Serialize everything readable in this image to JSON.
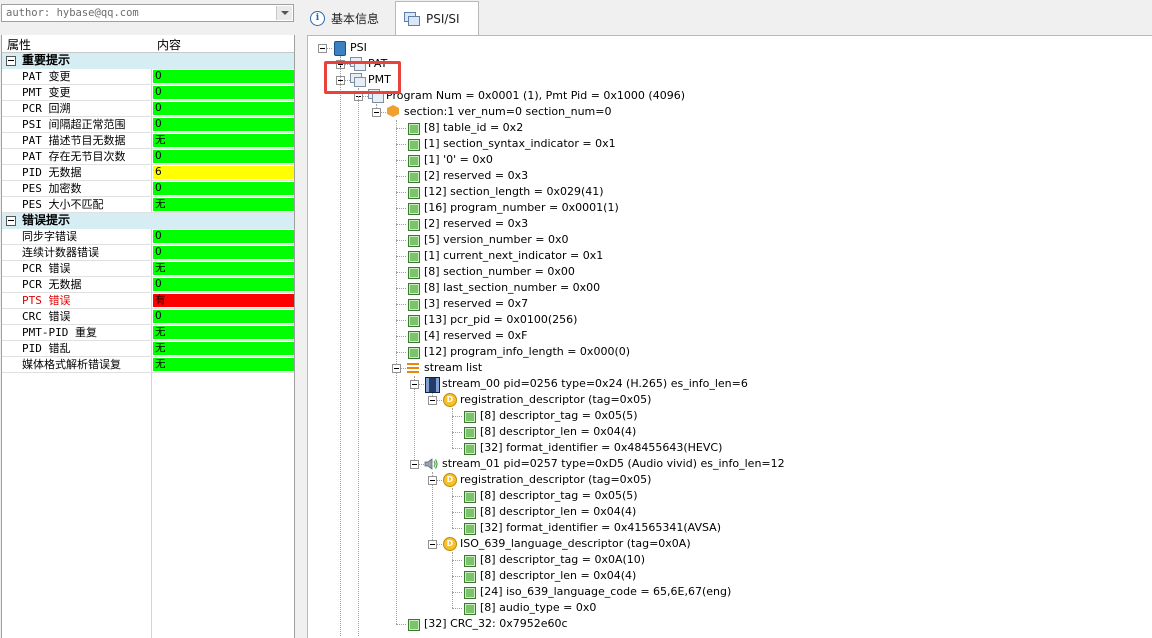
{
  "author_field": {
    "value": "author: hybase@qq.com"
  },
  "grid": {
    "header": {
      "col1": "属性",
      "col2": "内容"
    },
    "rows": [
      {
        "type": "category",
        "label": "重要提示"
      },
      {
        "type": "item",
        "label": "PAT 变更",
        "value": "0",
        "color": "#00ff00"
      },
      {
        "type": "item",
        "label": "PMT 变更",
        "value": "0",
        "color": "#00ff00"
      },
      {
        "type": "item",
        "label": "PCR 回溯",
        "value": "0",
        "color": "#00ff00"
      },
      {
        "type": "item",
        "label": "PSI 间隔超正常范围",
        "value": "0",
        "color": "#00ff00"
      },
      {
        "type": "item",
        "label": "PAT 描述节目无数据",
        "value": "无",
        "color": "#00ff00"
      },
      {
        "type": "item",
        "label": "PAT 存在无节目次数",
        "value": "0",
        "color": "#00ff00"
      },
      {
        "type": "item",
        "label": "PID 无数据",
        "value": "6",
        "color": "#ffff00"
      },
      {
        "type": "item",
        "label": "PES 加密数",
        "value": "0",
        "color": "#00ff00"
      },
      {
        "type": "item",
        "label": "PES 大小不匹配",
        "value": "无",
        "color": "#00ff00"
      },
      {
        "type": "category",
        "label": "错误提示"
      },
      {
        "type": "item",
        "label": "同步字错误",
        "value": "0",
        "color": "#00ff00"
      },
      {
        "type": "item",
        "label": "连续计数器错误",
        "value": "0",
        "color": "#00ff00"
      },
      {
        "type": "item",
        "label": "PCR 错误",
        "value": "无",
        "color": "#00ff00"
      },
      {
        "type": "item",
        "label": "PCR 无数据",
        "value": "0",
        "color": "#00ff00"
      },
      {
        "type": "item",
        "label": "PTS 错误",
        "value": "有",
        "color": "#ff0000",
        "red_label": true
      },
      {
        "type": "item",
        "label": "CRC 错误",
        "value": "0",
        "color": "#00ff00"
      },
      {
        "type": "item",
        "label": "PMT-PID 重复",
        "value": "无",
        "color": "#00ff00"
      },
      {
        "type": "item",
        "label": "PID 错乱",
        "value": "无",
        "color": "#00ff00"
      },
      {
        "type": "item",
        "label": "媒体格式解析错误复",
        "value": "无",
        "color": "#00ff00"
      }
    ]
  },
  "tabs": [
    {
      "label": "基本信息",
      "icon": "info-icon"
    },
    {
      "label": "PSI/SI",
      "icon": "psi-si-icon"
    }
  ],
  "tree": {
    "nodes": [
      {
        "label": "PSI",
        "icon": "psi",
        "level": 0,
        "box": "minus"
      },
      {
        "label": "PAT",
        "icon": "doc",
        "level": 1,
        "box": "plus"
      },
      {
        "label": "PMT",
        "icon": "doc",
        "level": 1,
        "box": "minus"
      },
      {
        "label": "Program Num = 0x0001 (1), Pmt Pid = 0x1000 (4096)",
        "icon": "doc",
        "level": 2,
        "box": "minus"
      },
      {
        "label": "section:1 ver_num=0 section_num=0",
        "icon": "hex",
        "level": 3,
        "box": "minus"
      },
      {
        "label": "[8] table_id = 0x2",
        "icon": "leaf",
        "level": 4
      },
      {
        "label": "[1] section_syntax_indicator = 0x1",
        "icon": "leaf",
        "level": 4
      },
      {
        "label": "[1] '0' = 0x0",
        "icon": "leaf",
        "level": 4
      },
      {
        "label": "[2] reserved = 0x3",
        "icon": "leaf",
        "level": 4
      },
      {
        "label": "[12] section_length = 0x029(41)",
        "icon": "leaf",
        "level": 4
      },
      {
        "label": "[16] program_number = 0x0001(1)",
        "icon": "leaf",
        "level": 4
      },
      {
        "label": "[2] reserved = 0x3",
        "icon": "leaf",
        "level": 4
      },
      {
        "label": "[5] version_number = 0x0",
        "icon": "leaf",
        "level": 4
      },
      {
        "label": "[1] current_next_indicator = 0x1",
        "icon": "leaf",
        "level": 4
      },
      {
        "label": "[8] section_number = 0x00",
        "icon": "leaf",
        "level": 4
      },
      {
        "label": "[8] last_section_number = 0x00",
        "icon": "leaf",
        "level": 4
      },
      {
        "label": "[3] reserved = 0x7",
        "icon": "leaf",
        "level": 4
      },
      {
        "label": "[13] pcr_pid = 0x0100(256)",
        "icon": "leaf",
        "level": 4
      },
      {
        "label": "[4] reserved = 0xF",
        "icon": "leaf",
        "level": 4
      },
      {
        "label": "[12] program_info_length = 0x000(0)",
        "icon": "leaf",
        "level": 4
      },
      {
        "label": "stream list",
        "icon": "list",
        "level": 4,
        "box": "minus"
      },
      {
        "label": "stream_00 pid=0256 type=0x24 (H.265) es_info_len=6",
        "icon": "film",
        "level": 5,
        "box": "minus"
      },
      {
        "label": "registration_descriptor (tag=0x05)",
        "icon": "d",
        "level": 6,
        "box": "minus"
      },
      {
        "label": "[8] descriptor_tag = 0x05(5)",
        "icon": "leaf",
        "level": 7
      },
      {
        "label": "[8] descriptor_len = 0x04(4)",
        "icon": "leaf",
        "level": 7
      },
      {
        "label": "[32] format_identifier = 0x48455643(HEVC)",
        "icon": "leaf",
        "level": 7
      },
      {
        "label": "stream_01 pid=0257 type=0xD5 (Audio vivid) es_info_len=12",
        "icon": "speaker",
        "level": 5,
        "box": "minus"
      },
      {
        "label": "registration_descriptor (tag=0x05)",
        "icon": "d",
        "level": 6,
        "box": "minus"
      },
      {
        "label": "[8] descriptor_tag = 0x05(5)",
        "icon": "leaf",
        "level": 7
      },
      {
        "label": "[8] descriptor_len = 0x04(4)",
        "icon": "leaf",
        "level": 7
      },
      {
        "label": "[32] format_identifier = 0x41565341(AVSA)",
        "icon": "leaf",
        "level": 7
      },
      {
        "label": "ISO_639_language_descriptor (tag=0x0A)",
        "icon": "d",
        "level": 6,
        "box": "minus"
      },
      {
        "label": "[8] descriptor_tag = 0x0A(10)",
        "icon": "leaf",
        "level": 7
      },
      {
        "label": "[8] descriptor_len = 0x04(4)",
        "icon": "leaf",
        "level": 7
      },
      {
        "label": "[24] iso_639_language_code = 65,6E,67(eng)",
        "icon": "leaf",
        "level": 7
      },
      {
        "label": "[8] audio_type = 0x0",
        "icon": "leaf",
        "level": 7
      },
      {
        "label": "[32] CRC_32: 0x7952e60c",
        "icon": "leaf",
        "level": 4
      }
    ]
  },
  "highlight_color": "#e8423c"
}
